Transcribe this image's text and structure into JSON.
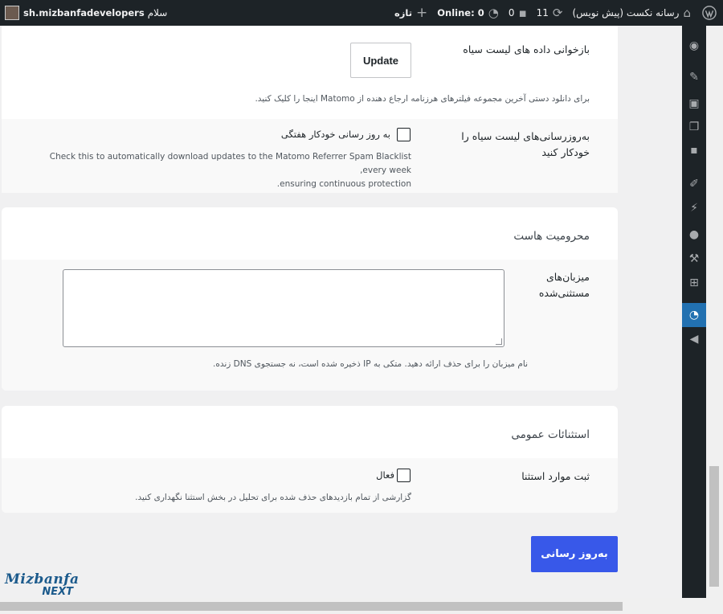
{
  "adminbar": {
    "site_name": "رسانه نکست (پیش نویس)",
    "updates_count": "11",
    "comments_count": "0",
    "online_label": "Online: 0",
    "new_label": "تازه",
    "greeting": "سلام",
    "username": "sh.mizbanfadevelopers"
  },
  "section_blacklist": {
    "reload_label": "بازخوانی داده های لیست سیاه",
    "update_button": "Update",
    "reload_desc": "برای دانلود دستی آخرین مجموعه فیلترهای هرزنامه ارجاع دهنده از Matomo اینجا را کلیک کنید.",
    "auto_label_line1": "به‌روزرسانی‌های لیست سیاه را",
    "auto_label_line2": "خودکار کنید",
    "auto_checkbox_label": "به روز رسانی خودکار هفتگی",
    "auto_desc_line1": "Check this to automatically download updates to the Matomo Referrer Spam Blacklist every week,",
    "auto_desc_line2": "ensuring continuous protection."
  },
  "section_host": {
    "title": "محرومیت هاست",
    "hosts_label_line1": "میزبان‌های",
    "hosts_label_line2": "مستثنی‌شده",
    "hosts_value": "",
    "hosts_desc": "نام میزبان را برای حذف ارائه دهید. متکی به IP ذخیره شده است، نه جستجوی DNS زنده."
  },
  "section_general": {
    "title": "استثنائات عمومی",
    "record_label": "ثبت موارد استثنا",
    "active_label": "فعال",
    "record_desc": "گزارشی از تمام بازدیدهای حذف شده برای تحلیل در بخش استثنا نگهداری کنید."
  },
  "submit_button": "به‌روز رسانی",
  "logo": {
    "top": "Mizbanfa",
    "bottom": "NEXT"
  },
  "colors": {
    "adminbar_bg": "#1d2327",
    "accent": "#2271b1",
    "primary_button": "#3858e9"
  }
}
